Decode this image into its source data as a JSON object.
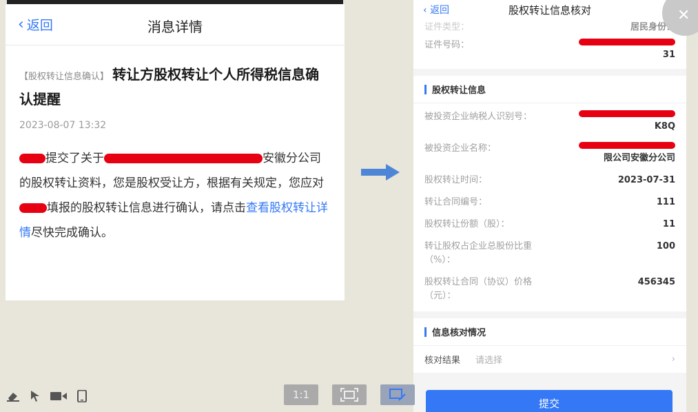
{
  "left": {
    "back_label": "返回",
    "title": "消息详情",
    "tag": "【股权转让信息确认】",
    "heading": "转让方股权转让个人所得税信息确认提醒",
    "date": "2023-08-07 13:32",
    "body_1": "提交了关于",
    "body_2": "安徽分公司的股权转让资料，您是股权受让方，根据有关规定，您应对",
    "body_3": "填报的股权转让信息进行确认，请点击",
    "link": "查看股权转让详情",
    "body_4": "尽快完成确认。"
  },
  "right": {
    "back_label": "返回",
    "title": "股权转让信息核对",
    "top_rows": [
      {
        "label": "证件类型：",
        "value": "居民身份证"
      },
      {
        "label": "证件号码：",
        "value": "31"
      }
    ],
    "section1_title": "股权转让信息",
    "rows": [
      {
        "label": "被投资企业纳税人识别号：",
        "value": "K8Q"
      },
      {
        "label": "被投资企业名称：",
        "value": "限公司安徽分公司"
      },
      {
        "label": "股权转让时间：",
        "value": "2023-07-31"
      },
      {
        "label": "转让合同编号：",
        "value": "111"
      },
      {
        "label": "股权转让份额（股）：",
        "value": "11"
      },
      {
        "label": "转让股权占企业总股份比重（%）：",
        "value": "100"
      },
      {
        "label": "股权转让合同（协议）价格（元）：",
        "value": "456345"
      }
    ],
    "section2_title": "信息核对情况",
    "check_label": "核对结果",
    "check_placeholder": "请选择",
    "submit_label": "提交"
  },
  "viewer": {
    "one_to_one": "1:1"
  },
  "icons": [
    "eraser-icon",
    "pointer-icon",
    "video-icon",
    "phone-icon",
    "fit-screen-icon",
    "edit-image-icon",
    "close-icon",
    "arrow-right-icon"
  ],
  "colors": {
    "accent": "#3478f6",
    "redaction": "#e60012"
  }
}
